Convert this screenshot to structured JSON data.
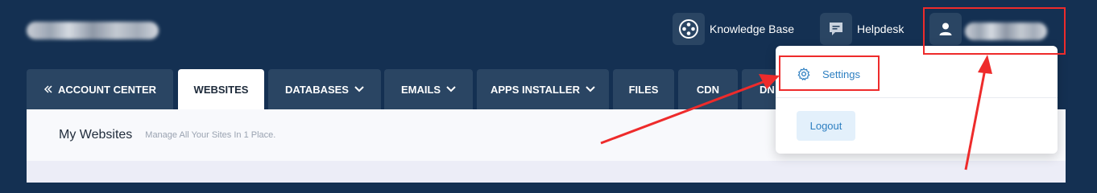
{
  "header": {
    "knowledge_base_label": "Knowledge Base",
    "helpdesk_label": "Helpdesk"
  },
  "tabs": [
    {
      "label": "ACCOUNT CENTER",
      "prefix_icon": "chevron-left-icon"
    },
    {
      "label": "WEBSITES",
      "active": true
    },
    {
      "label": "DATABASES",
      "dropdown": true
    },
    {
      "label": "EMAILS",
      "dropdown": true
    },
    {
      "label": "APPS INSTALLER",
      "dropdown": true
    },
    {
      "label": "FILES"
    },
    {
      "label": "CDN"
    },
    {
      "label": "DN"
    }
  ],
  "panel": {
    "title": "My Websites",
    "subtitle": "Manage All Your Sites In 1 Place."
  },
  "user_menu": {
    "settings_label": "Settings",
    "logout_label": "Logout"
  },
  "colors": {
    "header_bg": "#143052",
    "tab_bg": "#2a4563",
    "accent": "#2d7fc1",
    "annotation": "#ee2b2b"
  }
}
